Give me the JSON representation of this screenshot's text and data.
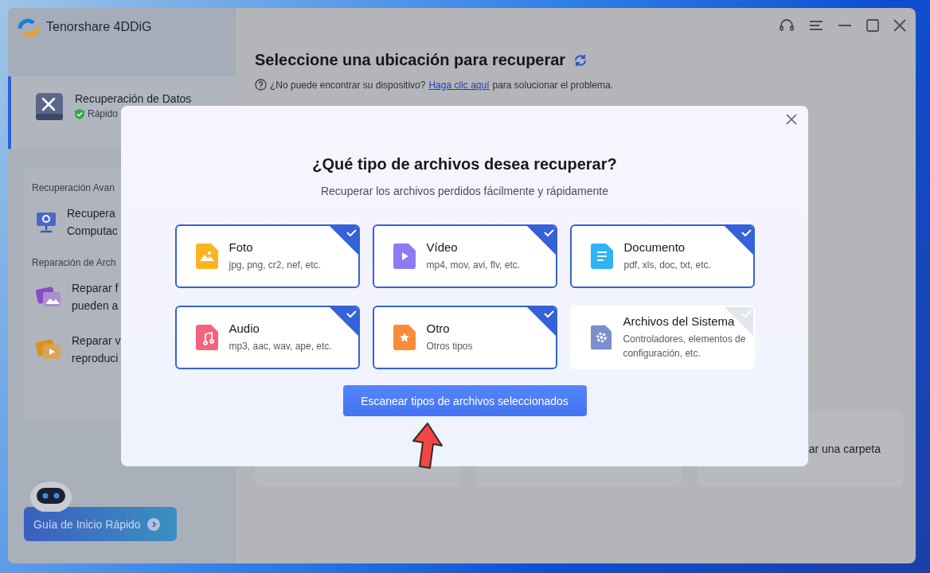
{
  "window": {
    "title": "Tenorshare 4DDiG"
  },
  "sidebar": {
    "primary": {
      "kind": "drive",
      "title": "Recuperación de Datos",
      "subtitle": "Rápido",
      "selected": true
    },
    "sections": [
      {
        "heading": "Recuperación Avan",
        "items": [
          {
            "kind": "computer",
            "lines": [
              "Recupera",
              "Computac"
            ]
          }
        ]
      },
      {
        "heading": "Reparación de Arch",
        "items": [
          {
            "kind": "photo",
            "lines": [
              "Reparar f",
              "pueden a"
            ]
          },
          {
            "kind": "video",
            "lines": [
              "Reparar v",
              "reproduci"
            ]
          }
        ]
      }
    ],
    "guide_button": "Guía de Inicio Rápido"
  },
  "main": {
    "title": "Seleccione una ubicación para recuperar",
    "help": {
      "before": "¿No puede encontrar su dispositivo?",
      "link": "Haga clic aquí",
      "after": "para solucionar el problema."
    },
    "cards": [
      {
        "kind": "blank"
      },
      {
        "kind": "blank"
      },
      {
        "kind": "labeled",
        "label": "ar una carpeta"
      }
    ]
  },
  "modal": {
    "title": "¿Qué tipo de archivos desea recuperar?",
    "subtitle": "Recuperar los archivos perdidos fácilmente y rápidamente",
    "file_types": [
      {
        "kind": "photo",
        "name": "Foto",
        "formats": "jpg, png, cr2, nef, etc.",
        "checked": true
      },
      {
        "kind": "video",
        "name": "Vídeo",
        "formats": "mp4, mov, avi, flv, etc.",
        "checked": true
      },
      {
        "kind": "document",
        "name": "Documento",
        "formats": "pdf, xls, doc, txt, etc.",
        "checked": true
      },
      {
        "kind": "audio",
        "name": "Audio",
        "formats": "mp3, aac, wav, ape, etc.",
        "checked": true
      },
      {
        "kind": "other",
        "name": "Otro",
        "formats": "Otros tipos",
        "checked": true
      },
      {
        "kind": "system",
        "name": "Archivos del Sistema",
        "formats": "Controladores, elementos de configuración, etc.",
        "checked": false
      }
    ],
    "scan_button": "Escanear tipos de archivos seleccionados"
  }
}
